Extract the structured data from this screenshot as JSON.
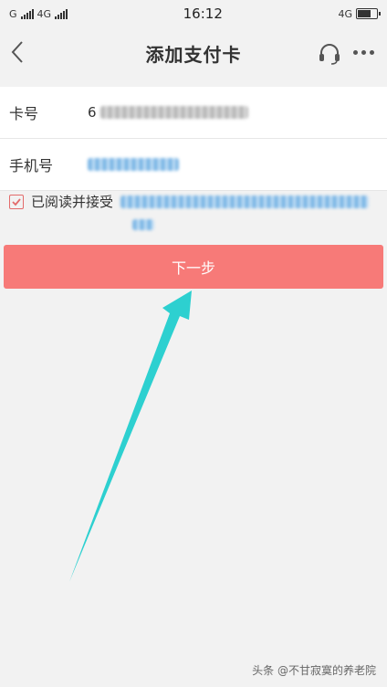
{
  "status_bar": {
    "carrier1": "G",
    "carrier2": "4G",
    "time": "16:12",
    "network_right": "4G"
  },
  "nav": {
    "title": "添加支付卡",
    "back_icon": "chevron-left-icon",
    "support_icon": "headset-icon",
    "more_icon": "more-icon"
  },
  "form": {
    "card_label": "卡号",
    "card_prefix": "6",
    "phone_label": "手机号"
  },
  "agreement": {
    "text": "已阅读并接受",
    "checked": true
  },
  "next_button": {
    "label": "下一步"
  },
  "colors": {
    "accent": "#f77a78",
    "arrow": "#2dd0d0",
    "check": "#e36b6b"
  },
  "watermark": "头条 @不甘寂寞的养老院"
}
